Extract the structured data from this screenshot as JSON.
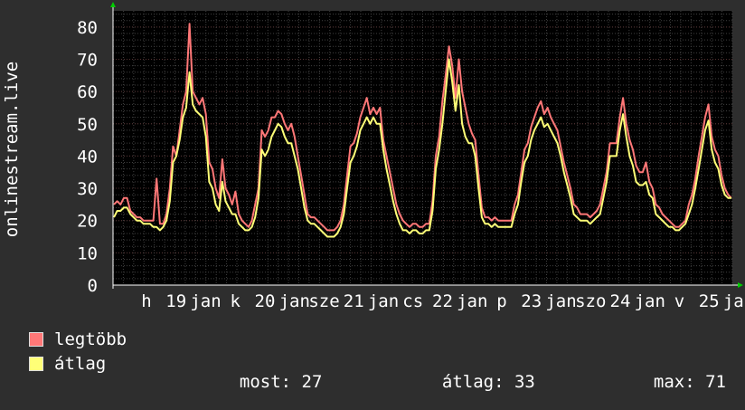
{
  "chart_data": {
    "type": "line",
    "ylabel": "onlinestream.live",
    "ylim": [
      0,
      85
    ],
    "y_ticks": [
      0,
      10,
      20,
      30,
      40,
      50,
      60,
      70,
      80
    ],
    "x_tick_labels": [
      "h",
      "19",
      "jan",
      "k",
      "20",
      "jan",
      "sze",
      "21",
      "jan",
      "cs",
      "22",
      "jan",
      "p",
      "23",
      "jan",
      "szo",
      "24",
      "jan",
      "v",
      "25",
      "jan"
    ],
    "grid": true,
    "colors": {
      "background": "#2e2e2e",
      "plot_bg": "#000000",
      "grid": "#404040",
      "axis": "#ffffff",
      "max_line": "#ff7777",
      "avg_line": "#ffff77",
      "arrow": "#00cc00"
    },
    "series": [
      {
        "name": "legtöbb",
        "color": "#ff7777",
        "values": [
          25,
          26,
          25,
          27,
          27,
          23,
          22,
          21,
          21,
          20,
          20,
          20,
          20,
          33,
          19,
          19,
          22,
          30,
          43,
          40,
          48,
          56,
          60,
          81,
          60,
          58,
          56,
          58,
          53,
          38,
          36,
          30,
          27,
          39,
          30,
          28,
          25,
          29,
          22,
          20,
          19,
          18,
          20,
          25,
          30,
          48,
          46,
          48,
          52,
          52,
          54,
          53,
          50,
          48,
          50,
          46,
          40,
          34,
          28,
          22,
          21,
          21,
          20,
          19,
          18,
          17,
          17,
          17,
          18,
          20,
          25,
          34,
          43,
          44,
          47,
          52,
          55,
          58,
          53,
          55,
          53,
          55,
          45,
          40,
          35,
          30,
          25,
          22,
          20,
          19,
          18,
          19,
          19,
          18,
          18,
          19,
          19,
          26,
          40,
          46,
          57,
          65,
          74,
          68,
          58,
          70,
          60,
          55,
          50,
          47,
          45,
          34,
          24,
          21,
          21,
          20,
          21,
          20,
          20,
          20,
          20,
          20,
          25,
          28,
          35,
          42,
          44,
          49,
          52,
          55,
          57,
          53,
          55,
          52,
          50,
          48,
          43,
          38,
          34,
          30,
          25,
          24,
          22,
          22,
          22,
          21,
          22,
          23,
          25,
          30,
          35,
          44,
          44,
          44,
          52,
          58,
          50,
          45,
          42,
          37,
          35,
          35,
          38,
          32,
          30,
          25,
          24,
          22,
          21,
          20,
          19,
          18,
          18,
          19,
          20,
          25,
          28,
          33,
          40,
          46,
          52,
          56,
          46,
          42,
          40,
          34,
          30,
          28,
          27
        ]
      },
      {
        "name": "átlag",
        "color": "#ffff77",
        "values": [
          21,
          23,
          23,
          24,
          24,
          22,
          21,
          20,
          20,
          19,
          19,
          19,
          18,
          18,
          17,
          18,
          20,
          26,
          38,
          40,
          45,
          52,
          55,
          66,
          56,
          54,
          53,
          52,
          46,
          32,
          30,
          25,
          23,
          32,
          26,
          24,
          22,
          22,
          19,
          18,
          17,
          17,
          18,
          21,
          27,
          42,
          40,
          42,
          46,
          48,
          50,
          49,
          46,
          44,
          44,
          40,
          36,
          30,
          24,
          20,
          19,
          19,
          18,
          17,
          16,
          15,
          15,
          15,
          16,
          18,
          22,
          30,
          38,
          40,
          43,
          48,
          50,
          52,
          50,
          52,
          50,
          50,
          42,
          36,
          31,
          26,
          22,
          19,
          17,
          17,
          16,
          17,
          17,
          16,
          16,
          17,
          17,
          23,
          36,
          42,
          50,
          60,
          70,
          63,
          54,
          62,
          50,
          46,
          44,
          44,
          40,
          30,
          21,
          19,
          19,
          18,
          19,
          18,
          18,
          18,
          18,
          18,
          22,
          25,
          32,
          38,
          40,
          45,
          48,
          50,
          52,
          49,
          50,
          48,
          46,
          44,
          40,
          35,
          31,
          27,
          22,
          21,
          20,
          20,
          20,
          19,
          20,
          21,
          22,
          27,
          32,
          40,
          40,
          40,
          48,
          53,
          46,
          40,
          37,
          32,
          31,
          31,
          32,
          28,
          27,
          22,
          21,
          20,
          19,
          18,
          18,
          17,
          17,
          18,
          19,
          22,
          25,
          30,
          36,
          42,
          48,
          51,
          42,
          38,
          36,
          31,
          28,
          27,
          27
        ]
      }
    ]
  },
  "legend": {
    "max_label": "legtöbb",
    "avg_label": "átlag",
    "now_label": "most:",
    "now_value": "27",
    "avg_stat_label": "átlag:",
    "avg_value": "33",
    "max_stat_label": "max:",
    "max_value": "71"
  }
}
